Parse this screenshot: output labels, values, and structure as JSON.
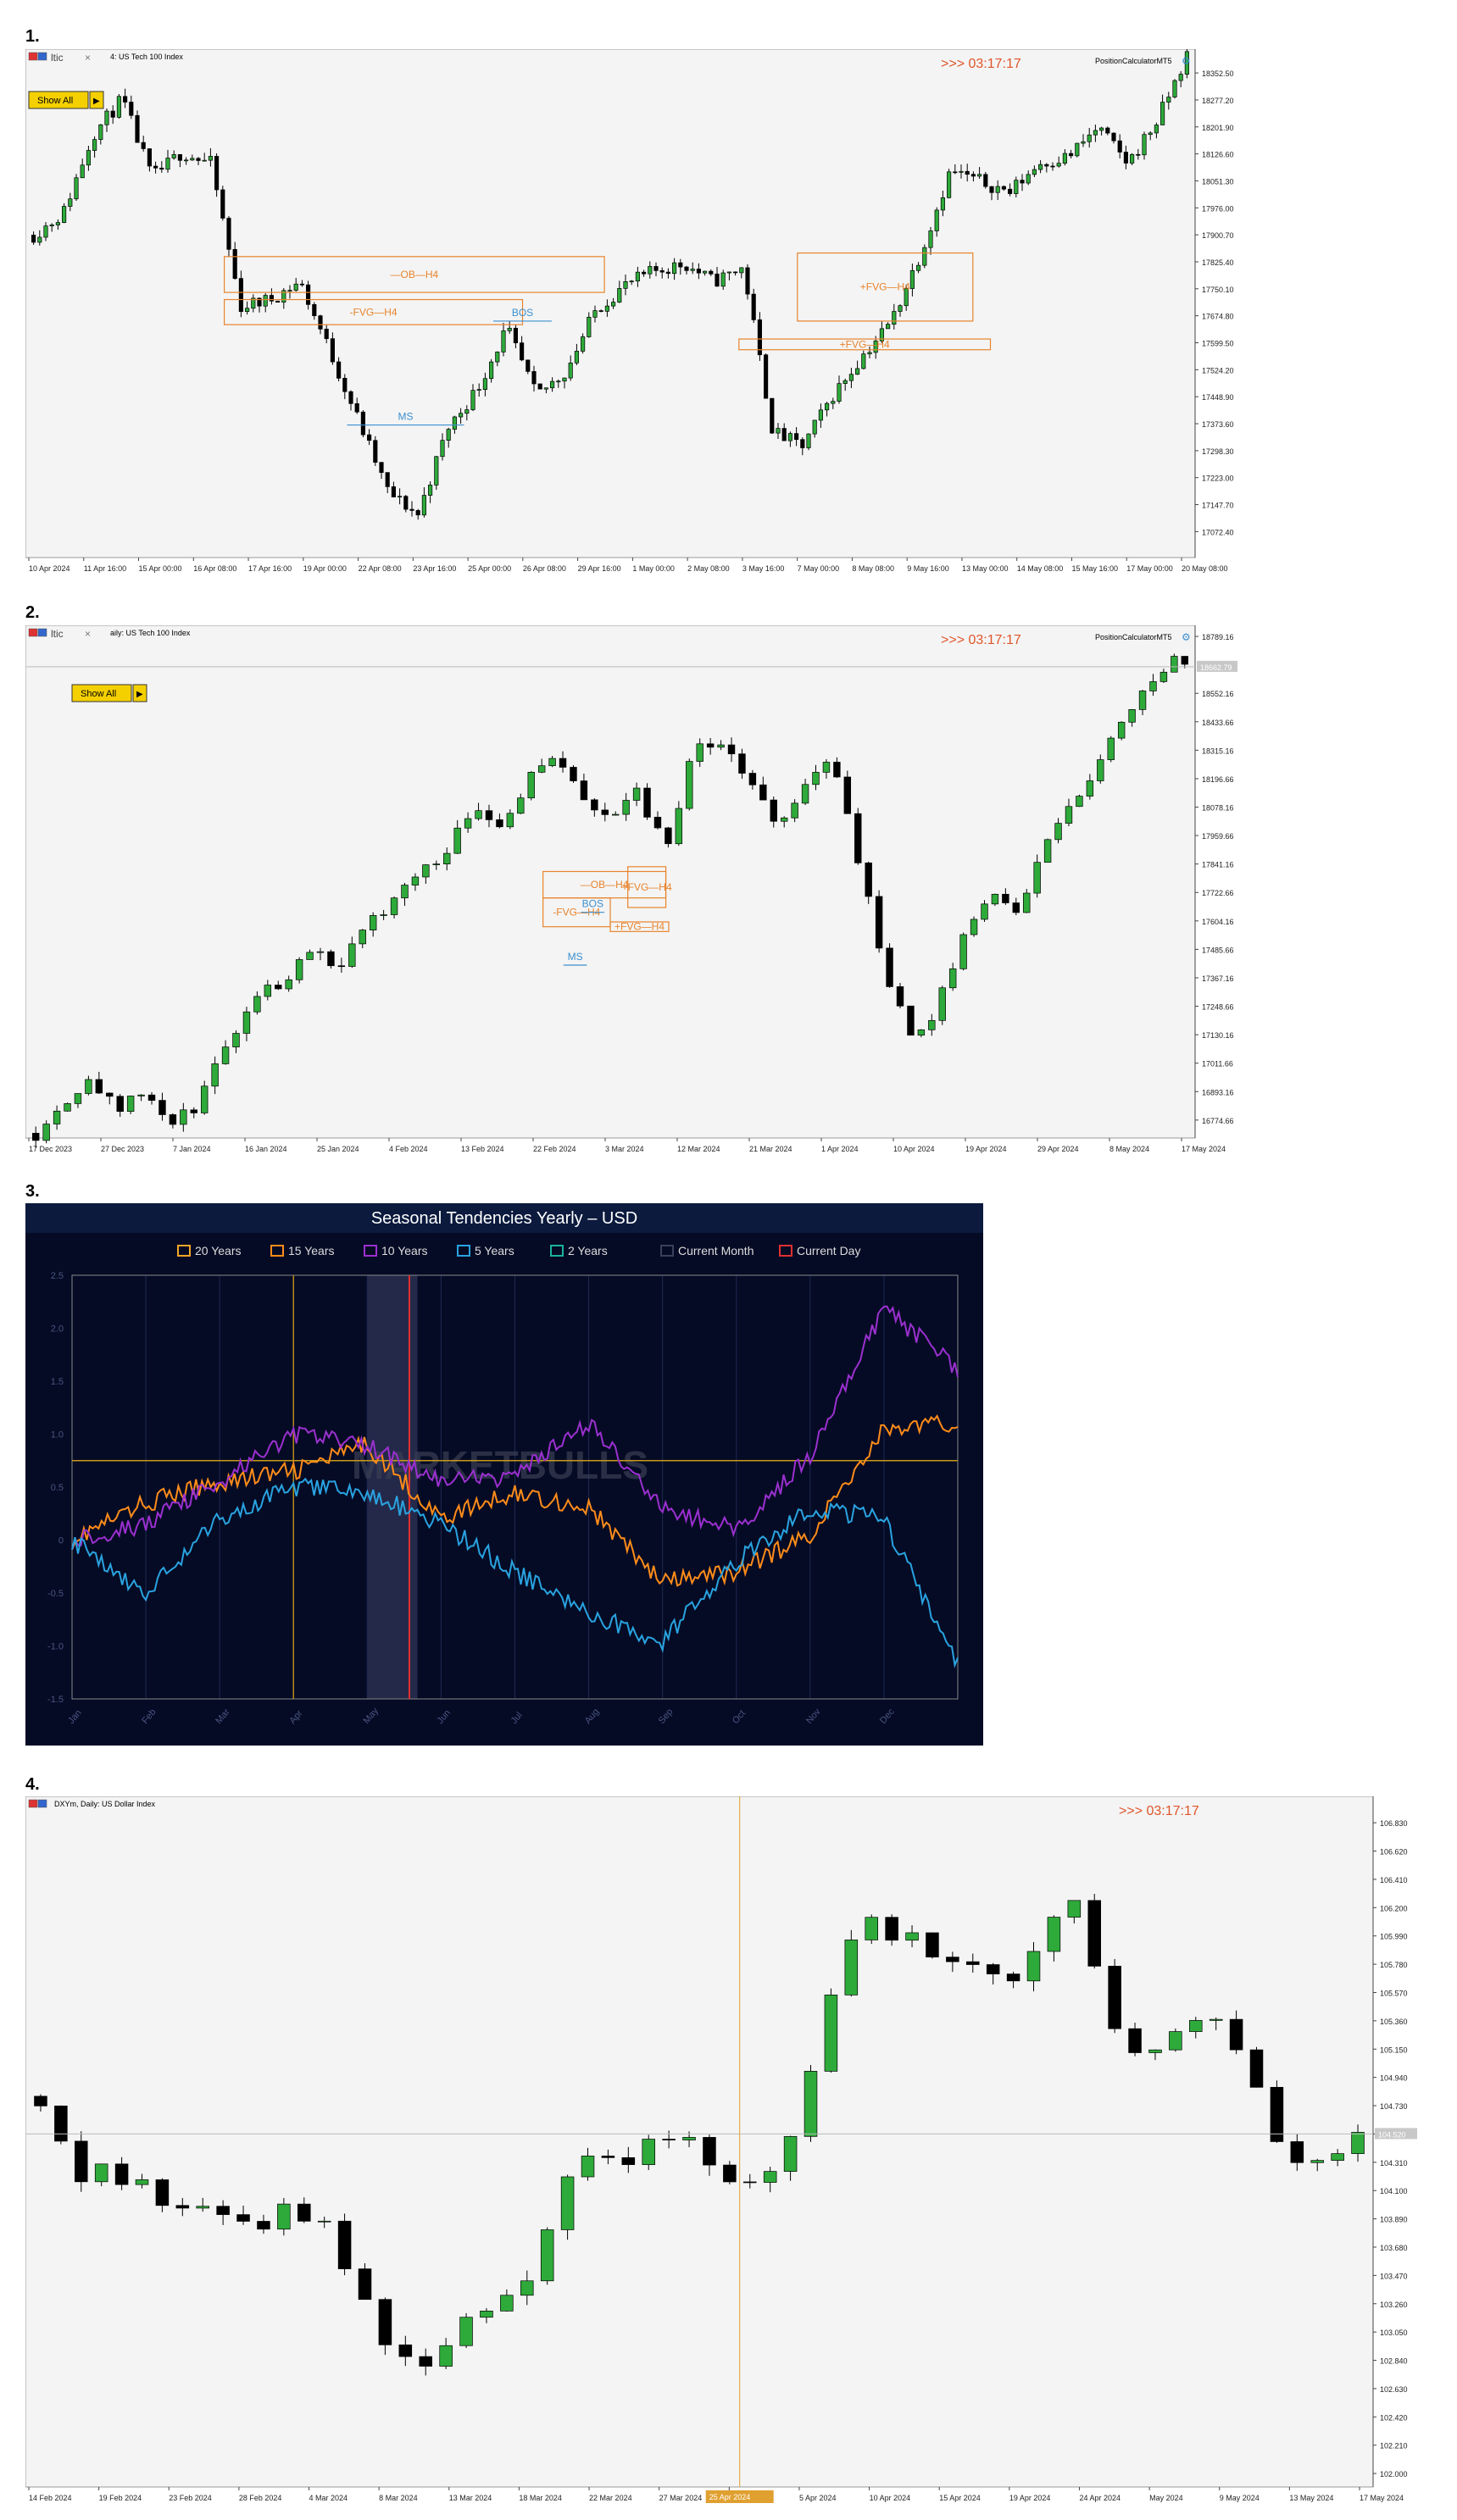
{
  "labels": [
    "1.",
    "2.",
    "3.",
    "4."
  ],
  "timer": ">>> 03:17:17",
  "calc": "PositionCalculatorMT5",
  "show_all": "Show All",
  "chart_data": [
    {
      "id": "c1",
      "type": "candlestick",
      "title_fragment": "ltic",
      "symbol": "4: US Tech 100 Index",
      "ylim": [
        17000,
        18400
      ],
      "y_ticks": [
        "18352.50",
        "18277.20",
        "18201.90",
        "18126.60",
        "18051.30",
        "17976.00",
        "17900.70",
        "17825.40",
        "17750.10",
        "17674.80",
        "17599.50",
        "17524.20",
        "17448.90",
        "17373.60",
        "17298.30",
        "17223.00",
        "17147.70",
        "17072.40"
      ],
      "y_tick_values": [
        18352.5,
        18277.2,
        18201.9,
        18126.6,
        18051.3,
        17976.0,
        17900.7,
        17825.4,
        17750.1,
        17674.8,
        17599.5,
        17524.2,
        17448.9,
        17373.6,
        17298.3,
        17223.0,
        17147.7,
        17072.4
      ],
      "x_ticks": [
        "10 Apr 2024",
        "11 Apr 16:00",
        "15 Apr 00:00",
        "16 Apr 08:00",
        "17 Apr 16:00",
        "19 Apr 00:00",
        "22 Apr 08:00",
        "23 Apr 16:00",
        "25 Apr 00:00",
        "26 Apr 08:00",
        "29 Apr 16:00",
        "1 May 00:00",
        "2 May 08:00",
        "3 May 16:00",
        "7 May 00:00",
        "8 May 08:00",
        "9 May 16:00",
        "13 May 00:00",
        "14 May 08:00",
        "15 May 16:00",
        "17 May 00:00",
        "20 May 08:00"
      ],
      "keypoints": [
        17900,
        17960,
        18180,
        18280,
        18060,
        18130,
        18100,
        17700,
        17720,
        17770,
        17580,
        17380,
        17180,
        17120,
        17360,
        17470,
        17640,
        17450,
        17520,
        17690,
        17760,
        17800,
        17820,
        17770,
        17810,
        17350,
        17310,
        17450,
        17560,
        17660,
        17850,
        18080,
        18050,
        18020,
        18100,
        18120,
        18200,
        18100,
        18220,
        18400
      ],
      "zones": [
        {
          "label": "—OB—H4",
          "x0": 0.34,
          "x1": 0.99,
          "y0": 17740,
          "y1": 17840,
          "color": "#e8842c"
        },
        {
          "label": "-FVG—H4",
          "x0": 0.34,
          "x1": 0.85,
          "y0": 17650,
          "y1": 17720,
          "color": "#e8842c"
        },
        {
          "label": "+FVG—H4",
          "x0": 1.32,
          "x1": 1.62,
          "y0": 17660,
          "y1": 17850,
          "color": "#e8842c"
        },
        {
          "label": "+FVG—H4",
          "x0": 1.22,
          "x1": 1.65,
          "y0": 17580,
          "y1": 17610,
          "color": "#e8842c"
        }
      ],
      "lines": [
        {
          "label": "BOS",
          "x0": 0.8,
          "x1": 0.9,
          "y": 17660,
          "color": "#3a8fd0"
        },
        {
          "label": "MS",
          "x0": 0.55,
          "x1": 0.75,
          "y": 17370,
          "color": "#3a8fd0"
        }
      ]
    },
    {
      "id": "c2",
      "type": "candlestick",
      "title_fragment": "ltic",
      "symbol": "aily: US Tech 100 Index",
      "ylim": [
        16700,
        18800
      ],
      "current_price_label": "18662.79",
      "y_ticks": [
        "18789.16",
        "18552.16",
        "18433.66",
        "18315.16",
        "18196.66",
        "18078.16",
        "17959.66",
        "17841.16",
        "17722.66",
        "17604.16",
        "17485.66",
        "17367.16",
        "17248.66",
        "17130.16",
        "17011.66",
        "16893.16",
        "16774.66"
      ],
      "y_tick_values": [
        18789.16,
        18552.16,
        18433.66,
        18315.16,
        18196.66,
        18078.16,
        17959.66,
        17841.16,
        17722.66,
        17604.16,
        17485.66,
        17367.16,
        17248.66,
        17130.16,
        17011.66,
        16893.16,
        16774.66
      ],
      "x_ticks": [
        "17 Dec 2023",
        "27 Dec 2023",
        "7 Jan 2024",
        "16 Jan 2024",
        "25 Jan 2024",
        "4 Feb 2024",
        "13 Feb 2024",
        "22 Feb 2024",
        "3 Mar 2024",
        "12 Mar 2024",
        "21 Mar 2024",
        "1 Apr 2024",
        "10 Apr 2024",
        "19 Apr 2024",
        "29 Apr 2024",
        "8 May 2024",
        "17 May 2024"
      ],
      "keypoints": [
        16720,
        16850,
        16960,
        16800,
        16900,
        16750,
        16850,
        17100,
        17300,
        17350,
        17500,
        17420,
        17550,
        17700,
        17800,
        17900,
        18100,
        18000,
        18200,
        18300,
        18100,
        18050,
        18150,
        17900,
        18300,
        18350,
        18200,
        18000,
        18150,
        18300,
        17900,
        17400,
        17100,
        17250,
        17600,
        17700,
        17650,
        17950,
        18100,
        18300,
        18500,
        18650,
        18700
      ],
      "zones": [
        {
          "label": "—OB—H4",
          "x0": 0.885,
          "x1": 1.095,
          "y0": 17700,
          "y1": 17810,
          "color": "#e8842c"
        },
        {
          "label": "-FVG—H4",
          "x0": 0.885,
          "x1": 1.0,
          "y0": 17580,
          "y1": 17700,
          "color": "#e8842c"
        },
        {
          "label": "+FVG—H4",
          "x0": 1.03,
          "x1": 1.095,
          "y0": 17660,
          "y1": 17830,
          "color": "#e8842c"
        },
        {
          "label": "+FVG—H4",
          "x0": 1.0,
          "x1": 1.1,
          "y0": 17560,
          "y1": 17600,
          "color": "#e8842c"
        }
      ],
      "lines": [
        {
          "label": "BOS",
          "x0": 0.95,
          "x1": 0.99,
          "y": 17640,
          "color": "#3a8fd0"
        },
        {
          "label": "MS",
          "x0": 0.92,
          "x1": 0.96,
          "y": 17420,
          "color": "#3a8fd0"
        }
      ]
    },
    {
      "id": "c3",
      "type": "line",
      "title": "Seasonal Tendencies Yearly – USD",
      "ylim": [
        -1.5,
        2.5
      ],
      "y_ticks": [
        "2.5",
        "2.0",
        "1.5",
        "1.0",
        "0.5",
        "0",
        "-0.5",
        "-1.0",
        "-1.5"
      ],
      "y_tick_values": [
        2.5,
        2.0,
        1.5,
        1.0,
        0.5,
        0,
        -0.5,
        -1.0,
        -1.5
      ],
      "x_ticks": [
        "Jan",
        "Feb",
        "Mar",
        "Apr",
        "May",
        "Jun",
        "Jul",
        "Aug",
        "Sep",
        "Oct",
        "Nov",
        "Dec"
      ],
      "watermark": "MARKETBULLS",
      "current_month": [
        4.0,
        4.68
      ],
      "current_day": 4.57,
      "threshold": 0.75,
      "legend": [
        {
          "label": "20 Years",
          "color": "#f5a623"
        },
        {
          "label": "15 Years",
          "color": "#ff8c1a"
        },
        {
          "label": "10 Years",
          "color": "#9b30d0"
        },
        {
          "label": "5 Years",
          "color": "#29a3e0"
        },
        {
          "label": "2 Years",
          "color": "#1ab29c"
        },
        {
          "label": "Current Month",
          "color": "#3a3f5a"
        },
        {
          "label": "Current Day",
          "color": "#e03030"
        }
      ],
      "series": [
        {
          "name": "15 Years",
          "color": "#ff8c1a",
          "values": [
            0.0,
            0.35,
            0.55,
            0.65,
            0.9,
            0.2,
            0.45,
            0.3,
            -0.4,
            -0.3,
            0.05,
            1.05,
            1.1
          ]
        },
        {
          "name": "10 Years",
          "color": "#9b30d0",
          "values": [
            0.0,
            0.15,
            0.55,
            1.0,
            0.9,
            0.55,
            0.6,
            1.1,
            0.3,
            0.1,
            0.8,
            2.2,
            1.6
          ]
        },
        {
          "name": "5 Years",
          "color": "#29a3e0",
          "values": [
            0.0,
            -0.5,
            0.2,
            0.5,
            0.45,
            0.15,
            -0.3,
            -0.7,
            -0.95,
            -0.2,
            0.3,
            0.2,
            -1.2
          ]
        }
      ]
    },
    {
      "id": "c4",
      "type": "candlestick",
      "symbol": "DXYm, Daily: US Dollar Index",
      "ylim": [
        101.9,
        106.9
      ],
      "current_price_label": "104.520",
      "crosshair_date": "25 Apr 2024",
      "y_ticks": [
        "106.830",
        "106.620",
        "106.410",
        "106.200",
        "105.990",
        "105.780",
        "105.570",
        "105.360",
        "105.150",
        "104.940",
        "104.730",
        "104.520",
        "104.310",
        "104.100",
        "103.890",
        "103.680",
        "103.470",
        "103.260",
        "103.050",
        "102.840",
        "102.630",
        "102.420",
        "102.210",
        "102.000"
      ],
      "y_tick_values": [
        106.83,
        106.62,
        106.41,
        106.2,
        105.99,
        105.78,
        105.57,
        105.36,
        105.15,
        104.94,
        104.73,
        104.52,
        104.31,
        104.1,
        103.89,
        103.68,
        103.47,
        103.26,
        103.05,
        102.84,
        102.63,
        102.42,
        102.21,
        102.0
      ],
      "x_ticks": [
        "14 Feb 2024",
        "19 Feb 2024",
        "23 Feb 2024",
        "28 Feb 2024",
        "4 Mar 2024",
        "8 Mar 2024",
        "13 Mar 2024",
        "18 Mar 2024",
        "22 Mar 2024",
        "27 Mar 2024",
        "1 Apr 2024",
        "5 Apr 2024",
        "10 Apr 2024",
        "15 Apr 2024",
        "19 Apr 2024",
        "24 Apr 2024",
        "May 2024",
        "9 May 2024",
        "13 May 2024",
        "17 May 2024"
      ],
      "keypoints": [
        104.8,
        104.2,
        104.25,
        104.1,
        104.0,
        103.9,
        103.8,
        104.0,
        103.8,
        103.3,
        102.8,
        102.85,
        103.1,
        103.3,
        103.6,
        104.3,
        104.3,
        104.4,
        104.6,
        104.2,
        104.1,
        104.5,
        105.3,
        106.2,
        106.0,
        105.9,
        105.8,
        105.6,
        105.9,
        106.3,
        105.3,
        105.1,
        105.3,
        105.4,
        105.0,
        104.2,
        104.35,
        104.5
      ]
    }
  ]
}
